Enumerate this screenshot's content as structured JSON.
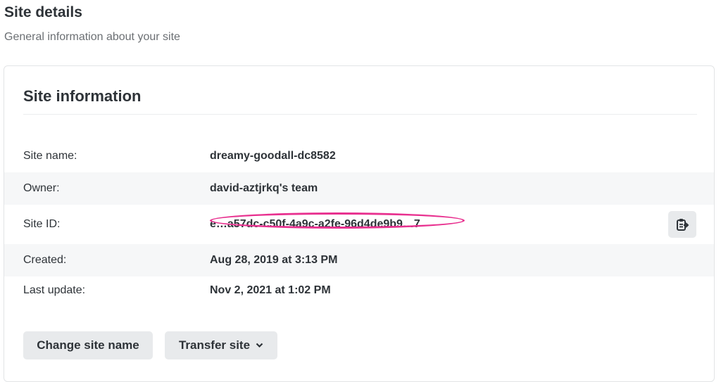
{
  "header": {
    "title": "Site details",
    "subtitle": "General information about your site"
  },
  "card": {
    "title": "Site information",
    "rows": [
      {
        "label": "Site name:",
        "value": "dreamy-goodall-dc8582"
      },
      {
        "label": "Owner:",
        "value": "david-aztjrkq's team"
      },
      {
        "label": "Site ID:",
        "value": "e…a57dc-c50f-4a9c-a2fe-96d4de9b9…7"
      },
      {
        "label": "Created:",
        "value": "Aug 28, 2019 at 3:13 PM"
      },
      {
        "label": "Last update:",
        "value": "Nov 2, 2021 at 1:02 PM"
      }
    ],
    "buttons": {
      "change_site_name": "Change site name",
      "transfer_site": "Transfer site"
    }
  },
  "icons": {
    "copy": "clipboard-copy-icon",
    "dropdown": "chevron-down-icon"
  },
  "colors": {
    "redaction_mark": "#e8308f",
    "button_bg": "#e8eaec",
    "row_alt_bg": "#f6f7f8"
  }
}
